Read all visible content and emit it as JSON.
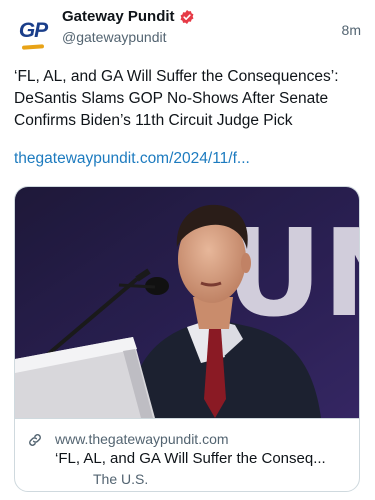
{
  "post": {
    "author": {
      "display_name": "Gateway Pundit",
      "handle": "@gatewaypundit",
      "avatar_text": "GP",
      "verified": true
    },
    "timestamp": "8m",
    "text": "‘FL, AL, and GA Will Suffer the Consequences’: DeSantis Slams GOP No-Shows After Senate Confirms Biden’s 11th Circuit Judge Pick",
    "link": "thegatewaypundit.com/2024/11/f...",
    "card": {
      "image_icon": "speaker-at-podium-photo",
      "backdrop_text": "UNI",
      "link_icon": "link-icon",
      "domain": "www.thegatewaypundit.com",
      "title": "‘FL, AL, and GA Will Suffer the Conseq...",
      "category": "The U.S."
    }
  },
  "colors": {
    "text": "#0f1419",
    "secondary": "#536471",
    "link": "#1d7bbf",
    "verified_badge": "#e63a46",
    "border": "#cfd9de",
    "brand_blue": "#1a3e8a",
    "brand_gold": "#e8a317"
  }
}
